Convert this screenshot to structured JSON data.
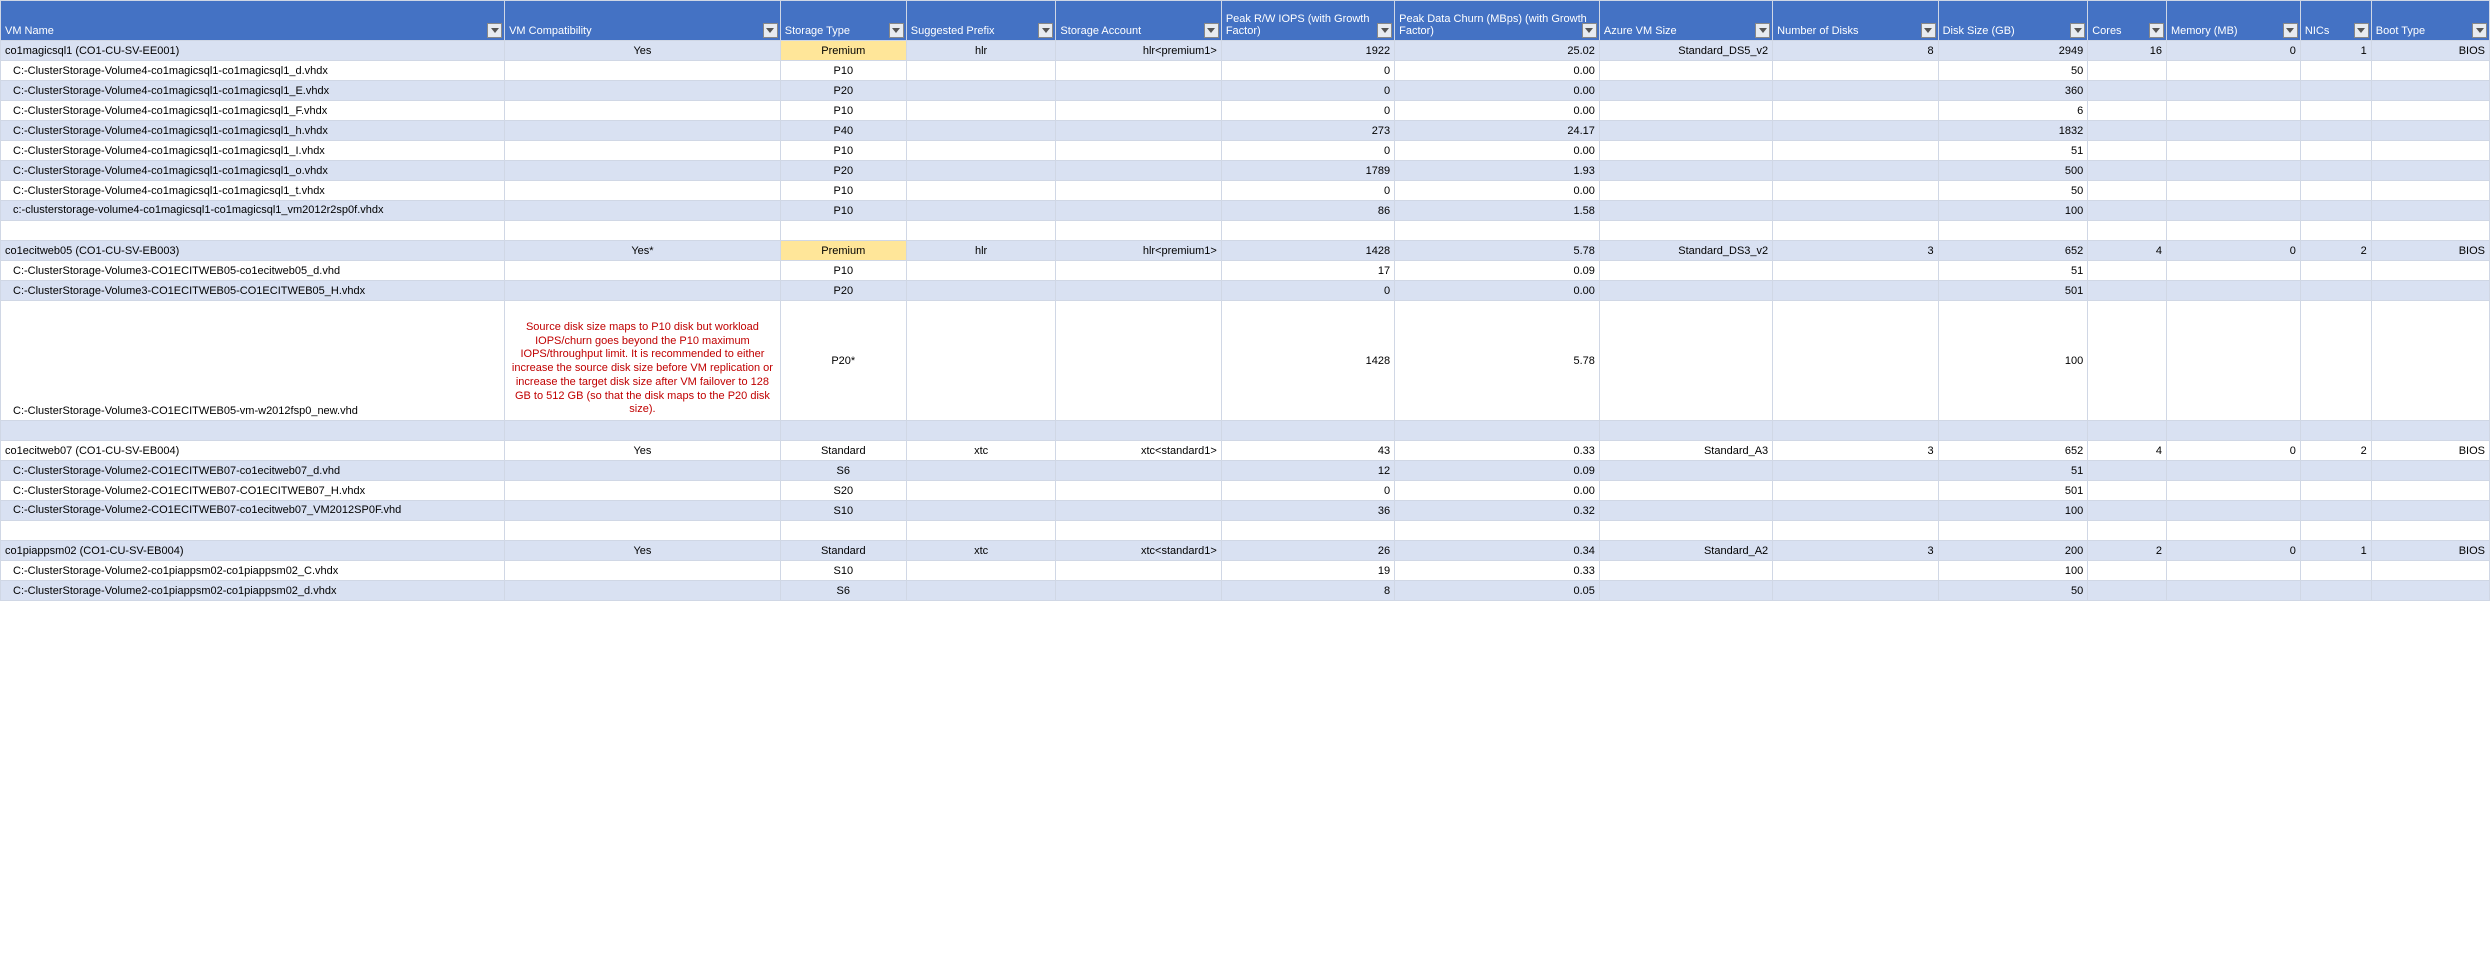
{
  "headers": {
    "vm": "VM Name",
    "comp": "VM Compatibility",
    "stype": "Storage Type",
    "pref": "Suggested Prefix",
    "acct": "Storage Account",
    "iops": "Peak R/W IOPS (with Growth Factor)",
    "churn": "Peak Data Churn (MBps) (with Growth Factor)",
    "vmsize": "Azure VM Size",
    "ndisks": "Number of Disks",
    "dsize": "Disk Size (GB)",
    "cores": "Cores",
    "mem": "Memory (MB)",
    "nic": "NICs",
    "boot": "Boot Type"
  },
  "rows": [
    {
      "class": "even",
      "vm": "co1magicsql1 (CO1-CU-SV-EE001)",
      "comp": "Yes",
      "stype": "Premium",
      "stype_hl": true,
      "pref": "hlr",
      "acct": "hlr<premium1>",
      "iops": "1922",
      "churn": "25.02",
      "vmsize": "Standard_DS5_v2",
      "ndisks": "8",
      "dsize": "2949",
      "cores": "16",
      "mem": "0",
      "nic": "1",
      "boot": "BIOS"
    },
    {
      "class": "odd",
      "vm": "C:-ClusterStorage-Volume4-co1magicsql1-co1magicsql1_d.vhdx",
      "stype": "P10",
      "iops": "0",
      "churn": "0.00",
      "dsize": "50",
      "indent": true
    },
    {
      "class": "even",
      "vm": "C:-ClusterStorage-Volume4-co1magicsql1-co1magicsql1_E.vhdx",
      "stype": "P20",
      "iops": "0",
      "churn": "0.00",
      "dsize": "360",
      "indent": true
    },
    {
      "class": "odd",
      "vm": "C:-ClusterStorage-Volume4-co1magicsql1-co1magicsql1_F.vhdx",
      "stype": "P10",
      "iops": "0",
      "churn": "0.00",
      "dsize": "6",
      "indent": true
    },
    {
      "class": "even",
      "vm": "C:-ClusterStorage-Volume4-co1magicsql1-co1magicsql1_h.vhdx",
      "stype": "P40",
      "iops": "273",
      "churn": "24.17",
      "dsize": "1832",
      "indent": true
    },
    {
      "class": "odd",
      "vm": "C:-ClusterStorage-Volume4-co1magicsql1-co1magicsql1_I.vhdx",
      "stype": "P10",
      "iops": "0",
      "churn": "0.00",
      "dsize": "51",
      "indent": true
    },
    {
      "class": "even",
      "vm": "C:-ClusterStorage-Volume4-co1magicsql1-co1magicsql1_o.vhdx",
      "stype": "P20",
      "iops": "1789",
      "churn": "1.93",
      "dsize": "500",
      "indent": true
    },
    {
      "class": "odd",
      "vm": "C:-ClusterStorage-Volume4-co1magicsql1-co1magicsql1_t.vhdx",
      "stype": "P10",
      "iops": "0",
      "churn": "0.00",
      "dsize": "50",
      "indent": true
    },
    {
      "class": "even",
      "vm": "c:-clusterstorage-volume4-co1magicsql1-co1magicsql1_vm2012r2sp0f.vhdx",
      "stype": "P10",
      "iops": "86",
      "churn": "1.58",
      "dsize": "100",
      "indent": true,
      "wrap": true
    },
    {
      "class": "odd",
      "blank": true
    },
    {
      "class": "even",
      "vm": "co1ecitweb05 (CO1-CU-SV-EB003)",
      "comp": "Yes*",
      "stype": "Premium",
      "stype_hl": true,
      "pref": "hlr",
      "acct": "hlr<premium1>",
      "iops": "1428",
      "churn": "5.78",
      "vmsize": "Standard_DS3_v2",
      "ndisks": "3",
      "dsize": "652",
      "cores": "4",
      "mem": "0",
      "nic": "2",
      "boot": "BIOS"
    },
    {
      "class": "odd",
      "vm": "C:-ClusterStorage-Volume3-CO1ECITWEB05-co1ecitweb05_d.vhd",
      "stype": "P10",
      "iops": "17",
      "churn": "0.09",
      "dsize": "51",
      "indent": true
    },
    {
      "class": "even",
      "vm": "C:-ClusterStorage-Volume3-CO1ECITWEB05-CO1ECITWEB05_H.vhdx",
      "stype": "P20",
      "iops": "0",
      "churn": "0.00",
      "dsize": "501",
      "indent": true
    },
    {
      "class": "odd",
      "vm": "C:-ClusterStorage-Volume3-CO1ECITWEB05-vm-w2012fsp0_new.vhd",
      "comp_warn": "Source disk size maps to P10 disk but workload IOPS/churn goes beyond the P10 maximum IOPS/throughput limit. It is recommended to either increase the source disk size before VM replication or increase the target disk size after VM failover to 128 GB to 512 GB (so that the disk maps to the P20 disk size).",
      "stype": "P20*",
      "iops": "1428",
      "churn": "5.78",
      "dsize": "100",
      "indent": true,
      "tall": true
    },
    {
      "class": "even",
      "blank": true
    },
    {
      "class": "odd",
      "vm": "co1ecitweb07 (CO1-CU-SV-EB004)",
      "comp": "Yes",
      "stype": "Standard",
      "pref": "xtc",
      "acct": "xtc<standard1>",
      "iops": "43",
      "churn": "0.33",
      "vmsize": "Standard_A3",
      "ndisks": "3",
      "dsize": "652",
      "cores": "4",
      "mem": "0",
      "nic": "2",
      "boot": "BIOS"
    },
    {
      "class": "even",
      "vm": "C:-ClusterStorage-Volume2-CO1ECITWEB07-co1ecitweb07_d.vhd",
      "stype": "S6",
      "iops": "12",
      "churn": "0.09",
      "dsize": "51",
      "indent": true
    },
    {
      "class": "odd",
      "vm": "C:-ClusterStorage-Volume2-CO1ECITWEB07-CO1ECITWEB07_H.vhdx",
      "stype": "S20",
      "iops": "0",
      "churn": "0.00",
      "dsize": "501",
      "indent": true
    },
    {
      "class": "even",
      "vm": "C:-ClusterStorage-Volume2-CO1ECITWEB07-co1ecitweb07_VM2012SP0F.vhd",
      "stype": "S10",
      "iops": "36",
      "churn": "0.32",
      "dsize": "100",
      "indent": true,
      "wrap": true
    },
    {
      "class": "odd",
      "blank": true
    },
    {
      "class": "even",
      "vm": "co1piappsm02 (CO1-CU-SV-EB004)",
      "comp": "Yes",
      "stype": "Standard",
      "pref": "xtc",
      "acct": "xtc<standard1>",
      "iops": "26",
      "churn": "0.34",
      "vmsize": "Standard_A2",
      "ndisks": "3",
      "dsize": "200",
      "cores": "2",
      "mem": "0",
      "nic": "1",
      "boot": "BIOS"
    },
    {
      "class": "odd",
      "vm": "C:-ClusterStorage-Volume2-co1piappsm02-co1piappsm02_C.vhdx",
      "stype": "S10",
      "iops": "19",
      "churn": "0.33",
      "dsize": "100",
      "indent": true
    },
    {
      "class": "even",
      "vm": "C:-ClusterStorage-Volume2-co1piappsm02-co1piappsm02_d.vhdx",
      "stype": "S6",
      "iops": "8",
      "churn": "0.05",
      "dsize": "50",
      "indent": true
    }
  ]
}
